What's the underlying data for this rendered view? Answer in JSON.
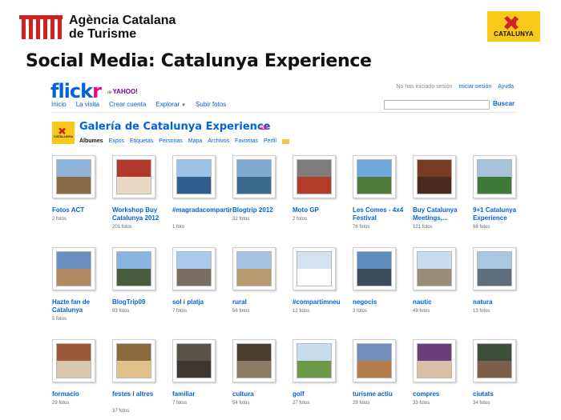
{
  "slide": {
    "org_line1": "Agència Catalana",
    "org_line2": "de Turisme",
    "badge": "CATALUNYA",
    "title": "Social Media: Catalunya Experience"
  },
  "flickr": {
    "logo_a": "flick",
    "logo_b": "r",
    "yahoo_prefix": "de",
    "yahoo": "YAHOO!",
    "top_status": "No has iniciado sesión",
    "signin": "Iniciar sesión",
    "help": "Ayuda",
    "nav": [
      "Inicio",
      "La visita",
      "Crear cuenta",
      "Explorar",
      "Subir fotos"
    ],
    "search_button": "Buscar",
    "search_value": ""
  },
  "gallery": {
    "avatar_word": "CATALUNYA",
    "title": "Galería de Catalunya Experience",
    "pro": "pro",
    "tabs": [
      "Álbumes",
      "Expos",
      "Etiquetas",
      "Personas",
      "Mapa",
      "Archivos",
      "Favoritas",
      "Perfil"
    ]
  },
  "albums": [
    {
      "title": "Fotos ACT",
      "count": "2 fotos",
      "sky": "#8fb3d9",
      "ground": "#8b6a4a"
    },
    {
      "title": "Workshop Buy Catalunya 2012",
      "count": "201 fotos",
      "sky": "#b23a2c",
      "ground": "#e8d9c5"
    },
    {
      "title": "#magradacompartir",
      "count": "1 foto",
      "sky": "#9cc3e6",
      "ground": "#2f5e8c"
    },
    {
      "title": "Blogtrip 2012",
      "count": "32 fotos",
      "sky": "#7fa9cf",
      "ground": "#3b6a8d"
    },
    {
      "title": "Moto GP",
      "count": "2 fotos",
      "sky": "#7d7d7d",
      "ground": "#b33b2a"
    },
    {
      "title": "Les Comes - 4x4 Festival",
      "count": "76 fotos",
      "sky": "#6ea7dc",
      "ground": "#4e7a3a"
    },
    {
      "title": "Buy Catalunya Meetings,...",
      "count": "121 fotos",
      "sky": "#7a3b26",
      "ground": "#4a2a1e"
    },
    {
      "title": "9+1 Catalunya Experience",
      "count": "68 fotos",
      "sky": "#a8c3d8",
      "ground": "#3f7a3a"
    },
    {
      "title": "Hazte fan de Catalunya",
      "count": "5 fotos",
      "sky": "#6b8ec2",
      "ground": "#b08a5e"
    },
    {
      "title": "BlogTrip09",
      "count": "93 fotos",
      "sky": "#8ab4e0",
      "ground": "#4a5c3e"
    },
    {
      "title": "sol i platja",
      "count": "7 fotos",
      "sky": "#a9c9ea",
      "ground": "#7a6e62"
    },
    {
      "title": "rural",
      "count": "56 fotos",
      "sky": "#a6c4e2",
      "ground": "#b79a6c"
    },
    {
      "title": "#compartimneu",
      "count": "12 fotos",
      "sky": "#d6e2ee",
      "ground": "#ffffff"
    },
    {
      "title": "negocis",
      "count": "3 fotos",
      "sky": "#5f8bbf",
      "ground": "#3c4a5a"
    },
    {
      "title": "nautic",
      "count": "49 fotos",
      "sky": "#c6dbee",
      "ground": "#9a8d78"
    },
    {
      "title": "natura",
      "count": "13 fotos",
      "sky": "#a9c7e3",
      "ground": "#5d6e7a"
    },
    {
      "title": "formacio",
      "count": "29 fotos",
      "sky": "#9a5a3a",
      "ground": "#d9c7b0"
    },
    {
      "title": "festes i altres",
      "count": "37 fotos",
      "sky": "#8a6a3e",
      "ground": "#e0c18a"
    },
    {
      "title": "familiar",
      "count": "7 fotos",
      "sky": "#5a5148",
      "ground": "#3c3530"
    },
    {
      "title": "cultura",
      "count": "54 fotos",
      "sky": "#4a3d32",
      "ground": "#8c7a63"
    },
    {
      "title": "golf",
      "count": "27 fotos",
      "sky": "#c9dcee",
      "ground": "#6d9a4a"
    },
    {
      "title": "turisme actiu",
      "count": "29 fotos",
      "sky": "#6f8fb8",
      "ground": "#b57c4a"
    },
    {
      "title": "compres",
      "count": "33 fotos",
      "sky": "#6a3e7a",
      "ground": "#d8c0a8"
    },
    {
      "title": "ciutats",
      "count": "34 fotos",
      "sky": "#3d4e3a",
      "ground": "#7a5f4a"
    }
  ]
}
